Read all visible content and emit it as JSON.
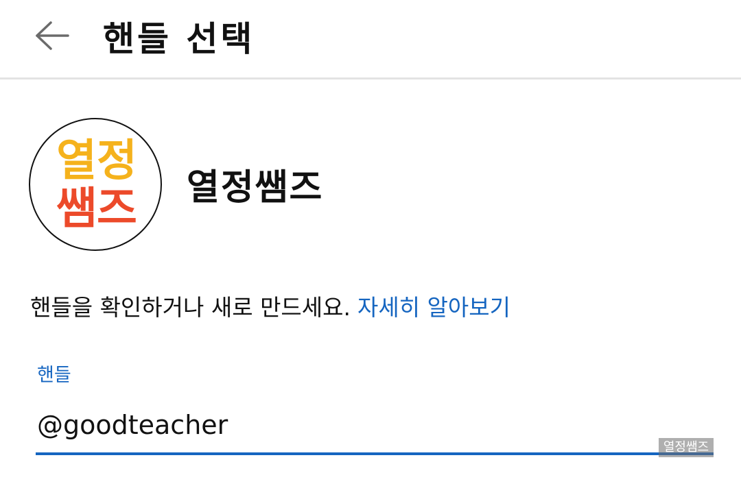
{
  "header": {
    "back_icon": "arrow-left-icon",
    "title": "핸들 선택"
  },
  "profile": {
    "avatar_text_line1": "열정",
    "avatar_text_line2": "쌤즈",
    "avatar_colors": {
      "line1": "#f5b21c",
      "line2": "#ec4a2a"
    },
    "channel_name": "열정쌤즈"
  },
  "description": {
    "text": "핸들을 확인하거나 새로 만드세요.",
    "link": "자세히 알아보기"
  },
  "handle_field": {
    "label": "핸들",
    "value": "@goodteacher"
  },
  "watermark": "열정쌤즈",
  "colors": {
    "accent": "#1565c0",
    "divider": "#e3e3e3"
  }
}
